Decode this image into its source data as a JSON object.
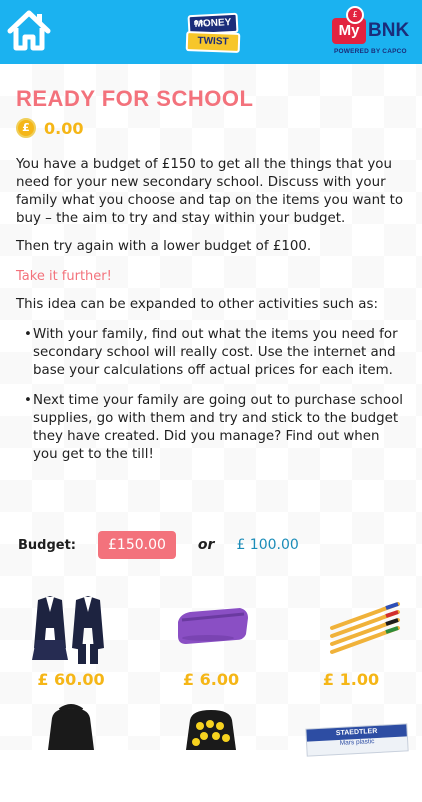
{
  "header": {
    "home_icon": "home-icon",
    "money_twist_logo": {
      "top": "MONEY",
      "bottom": "TWIST",
      "small": "MRL"
    },
    "mybnk_logo": {
      "my": "My",
      "bnk": "BNK",
      "coin": "£",
      "powered_by": "POWERED BY CAPCO"
    }
  },
  "page": {
    "title": "READY FOR SCHOOL",
    "score": "0.00",
    "intro": "You have a budget of £150 to get all the things that you need for your new secondary school. Discuss with your family what you choose and tap on the items you want to buy – the aim to try and stay within your budget.",
    "retry": "Then try again with a lower budget of £100.",
    "take_further": "Take it further!",
    "expand": "This idea can be expanded to other activities such as:",
    "bullets": [
      "With your family, find out what the items you need for secondary school will really cost. Use the internet and base your calculations off actual prices for each item.",
      "Next time your family are going out to purchase school supplies, go with them and try and stick to the budget they have created. Did you manage? Find out when you get to the till!"
    ]
  },
  "budget": {
    "label": "Budget:",
    "selected": "£150.00",
    "or_label": "or",
    "alternative": "£ 100.00"
  },
  "items": [
    {
      "name": "uniform",
      "price": "£ 60.00"
    },
    {
      "name": "pencil case",
      "price": "£ 6.00"
    },
    {
      "name": "pens",
      "price": "£ 1.00"
    },
    {
      "name": "backpack black"
    },
    {
      "name": "backpack emoji"
    },
    {
      "name": "staedtler eraser",
      "brand": "STAEDTLER",
      "sub": "Mars plastic"
    }
  ],
  "colors": {
    "header_bg": "#1bb2f0",
    "accent": "#f3727c",
    "coin": "#f5b617",
    "link": "#1b8cb8"
  }
}
